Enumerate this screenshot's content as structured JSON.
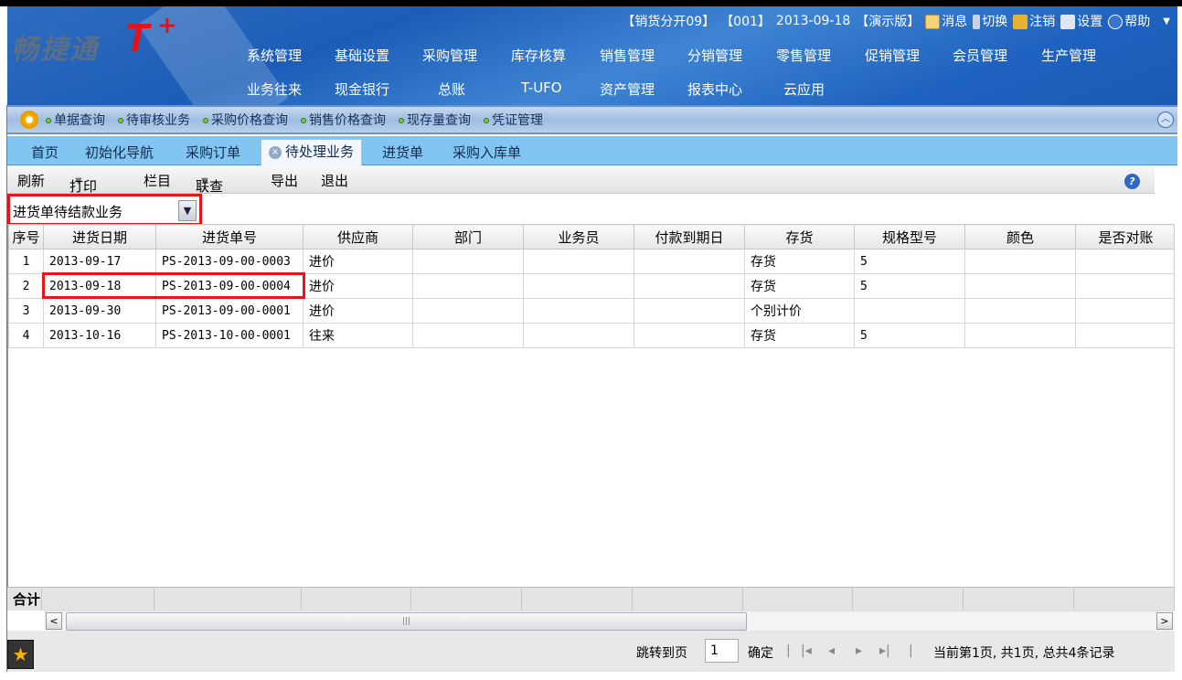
{
  "header": {
    "logo_text": "畅捷通",
    "logo_mark": "T",
    "logo_plus": "+",
    "status": {
      "account": "【销货分开09】",
      "user": "【001】",
      "date": "2013-09-18",
      "edition": "【演示版】",
      "message": "消息",
      "switch": "切换",
      "logout": "注销",
      "settings": "设置",
      "help": "帮助"
    },
    "nav_row1": [
      "系统管理",
      "基础设置",
      "采购管理",
      "库存核算",
      "销售管理",
      "分销管理",
      "零售管理",
      "促销管理",
      "会员管理",
      "生产管理"
    ],
    "nav_row2": [
      "业务往来",
      "现金银行",
      "总账",
      "T-UFO",
      "资产管理",
      "报表中心",
      "云应用"
    ]
  },
  "quicklinks": [
    "单据查询",
    "待审核业务",
    "采购价格查询",
    "销售价格查询",
    "现存量查询",
    "凭证管理"
  ],
  "tabs": [
    "首页",
    "初始化导航",
    "采购订单",
    "待处理业务",
    "进货单",
    "采购入库单"
  ],
  "toolbar": {
    "refresh": "刷新",
    "print": "打印",
    "columns": "栏目",
    "query": "联查",
    "export": "导出",
    "exit": "退出"
  },
  "filter": {
    "selected": "进货单待结款业务"
  },
  "table": {
    "columns": [
      "序号",
      "进货日期",
      "进货单号",
      "供应商",
      "部门",
      "业务员",
      "付款到期日",
      "存货",
      "规格型号",
      "颜色",
      "是否对账"
    ],
    "rows": [
      [
        "1",
        "2013-09-17",
        "PS-2013-09-00-0003",
        "进价",
        "",
        "",
        "",
        "存货",
        "5",
        "",
        ""
      ],
      [
        "2",
        "2013-09-18",
        "PS-2013-09-00-0004",
        "进价",
        "",
        "",
        "",
        "存货",
        "5",
        "",
        ""
      ],
      [
        "3",
        "2013-09-30",
        "PS-2013-09-00-0001",
        "进价",
        "",
        "",
        "",
        "个别计价",
        "",
        "",
        ""
      ],
      [
        "4",
        "2013-10-16",
        "PS-2013-10-00-0001",
        "往来",
        "",
        "",
        "",
        "存货",
        "5",
        "",
        ""
      ]
    ],
    "totals_label": "合计"
  },
  "pager": {
    "goto_label": "跳转到页",
    "page_value": "1",
    "confirm": "确定",
    "summary": "当前第1页, 共1页, 总共4条记录"
  },
  "colors": {
    "highlight": "#e8141a",
    "header_blue": "#1b5db8",
    "tab_bar": "#80c6f0"
  }
}
